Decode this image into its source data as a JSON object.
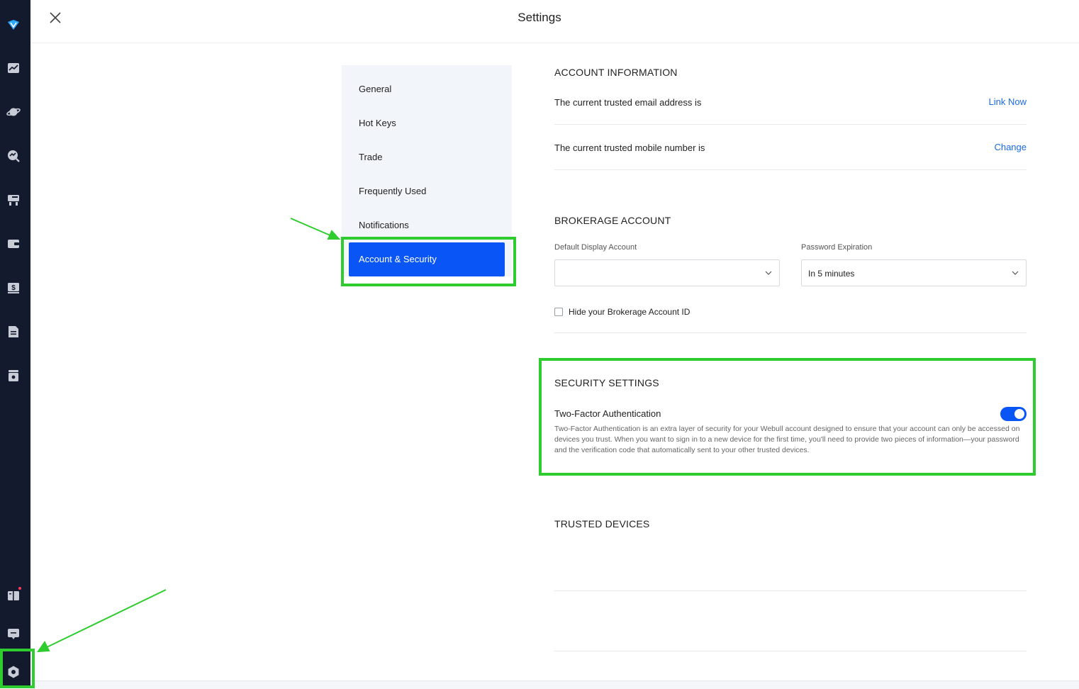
{
  "header": {
    "title": "Settings"
  },
  "nav": {
    "items": [
      {
        "label": "General"
      },
      {
        "label": "Hot Keys"
      },
      {
        "label": "Trade"
      },
      {
        "label": "Frequently Used"
      },
      {
        "label": "Notifications"
      },
      {
        "label": "Account & Security",
        "active": true
      }
    ]
  },
  "account_information": {
    "title": "ACCOUNT INFORMATION",
    "email_label": "The current trusted email address is",
    "email_action": "Link Now",
    "mobile_label": "The current trusted mobile number is",
    "mobile_action": "Change"
  },
  "brokerage_account": {
    "title": "BROKERAGE ACCOUNT",
    "default_display_label": "Default Display Account",
    "default_display_value": "",
    "password_expiration_label": "Password Expiration",
    "password_expiration_value": "In 5 minutes",
    "hide_id_label": "Hide your Brokerage Account ID",
    "hide_id_checked": false
  },
  "security_settings": {
    "title": "SECURITY SETTINGS",
    "two_factor_label": "Two-Factor Authentication",
    "two_factor_enabled": true,
    "two_factor_description": "Two-Factor Authentication is an extra layer of security for your Webull account designed to ensure that your account can only be accessed on devices you trust. When you want to sign in to a new device for the first time, you'll need to provide two pieces of information—your password and the verification code that automatically sent to your other trusted devices."
  },
  "trusted_devices": {
    "title": "TRUSTED DEVICES"
  },
  "colors": {
    "rail": "#141a2e",
    "accent": "#0a55f6",
    "link": "#1a6be8",
    "highlight": "#2ecc2e"
  },
  "rail_icons": [
    "webull-logo-icon",
    "chart-icon",
    "planet-icon",
    "market-scan-icon",
    "screener-icon",
    "wallet-icon",
    "money-icon",
    "document-icon",
    "archive-icon",
    "news-icon",
    "chat-icon",
    "settings-icon"
  ]
}
